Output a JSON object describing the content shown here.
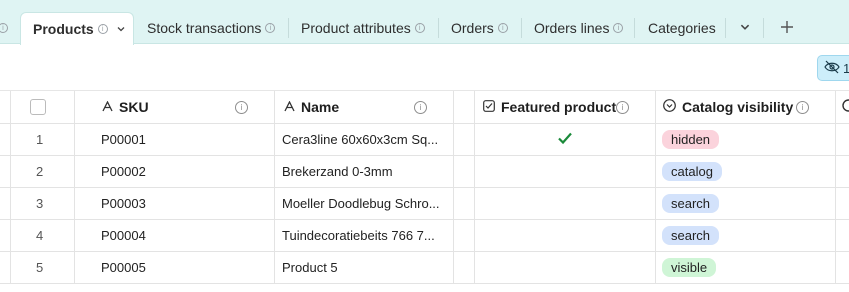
{
  "tabs": [
    {
      "label": "Products",
      "active": true
    },
    {
      "label": "Stock transactions"
    },
    {
      "label": "Product attributes"
    },
    {
      "label": "Orders"
    },
    {
      "label": "Orders lines"
    },
    {
      "label": "Categories"
    }
  ],
  "toolbar": {
    "hidden_fields_count": "1"
  },
  "columns": {
    "sku": "SKU",
    "name": "Name",
    "featured": "Featured product",
    "visibility": "Catalog visibility"
  },
  "rows": [
    {
      "num": "1",
      "sku": "P00001",
      "name": "Cera3line 60x60x3cm Sq...",
      "featured": true,
      "visibility": "hidden"
    },
    {
      "num": "2",
      "sku": "P00002",
      "name": "Brekerzand 0-3mm",
      "featured": false,
      "visibility": "catalog"
    },
    {
      "num": "3",
      "sku": "P00003",
      "name": "Moeller Doodlebug Schro...",
      "featured": false,
      "visibility": "search"
    },
    {
      "num": "4",
      "sku": "P00004",
      "name": "Tuindecoratiebeits 766 7...",
      "featured": false,
      "visibility": "search"
    },
    {
      "num": "5",
      "sku": "P00005",
      "name": "Product 5",
      "featured": false,
      "visibility": "visible"
    }
  ],
  "colors": {
    "hidden": "#fbd3dc",
    "catalog": "#d3e2fb",
    "search": "#d3e2fb",
    "visible": "#cff5d6",
    "check": "#1a8a3a",
    "accent": "#dff4f3"
  },
  "icons": [
    "info-icon",
    "chevron-down-icon",
    "plus-icon",
    "eye-off-icon",
    "text-field-icon",
    "checkbox-field-icon",
    "select-field-icon",
    "checkmark-icon"
  ]
}
